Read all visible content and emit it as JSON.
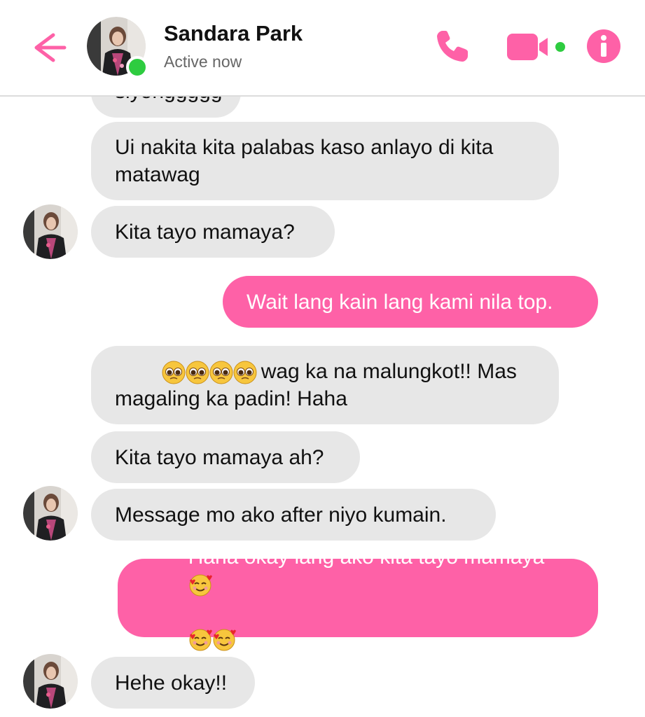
{
  "header": {
    "contact_name": "Sandara Park",
    "status": "Active now",
    "accent_color": "#fe61a7",
    "presence_color": "#2ecc40",
    "icons": [
      "back-arrow-icon",
      "phone-icon",
      "video-camera-icon",
      "info-icon"
    ]
  },
  "messages": [
    {
      "direction": "incoming",
      "text": "siyonggggg",
      "partial": true
    },
    {
      "direction": "incoming",
      "text": "Ui nakita kita palabas kaso anlayo di kita matawag"
    },
    {
      "direction": "incoming",
      "text": "Kita tayo mamaya?",
      "avatar": true
    },
    {
      "direction": "outgoing",
      "text": "Wait lang kain lang kami nila top."
    },
    {
      "direction": "incoming",
      "emojis": [
        "pleading-face",
        "pleading-face",
        "pleading-face",
        "pleading-face"
      ],
      "text": "wag ka na malungkot!! Mas magaling ka padin! Haha"
    },
    {
      "direction": "incoming",
      "text": "Kita tayo mamaya ah?"
    },
    {
      "direction": "incoming",
      "text": "Message mo ako after niyo kumain.",
      "avatar": true
    },
    {
      "direction": "outgoing",
      "text": "Haha okay lang ako kita tayo mamaya",
      "emojis": [
        "smiling-face-with-hearts",
        "smiling-face-with-hearts",
        "smiling-face-with-hearts"
      ]
    },
    {
      "direction": "incoming",
      "text": "Hehe okay!!",
      "avatar": true
    }
  ],
  "colors": {
    "incoming_bubble": "#e7e7e7",
    "outgoing_bubble": "#fe61a7"
  }
}
